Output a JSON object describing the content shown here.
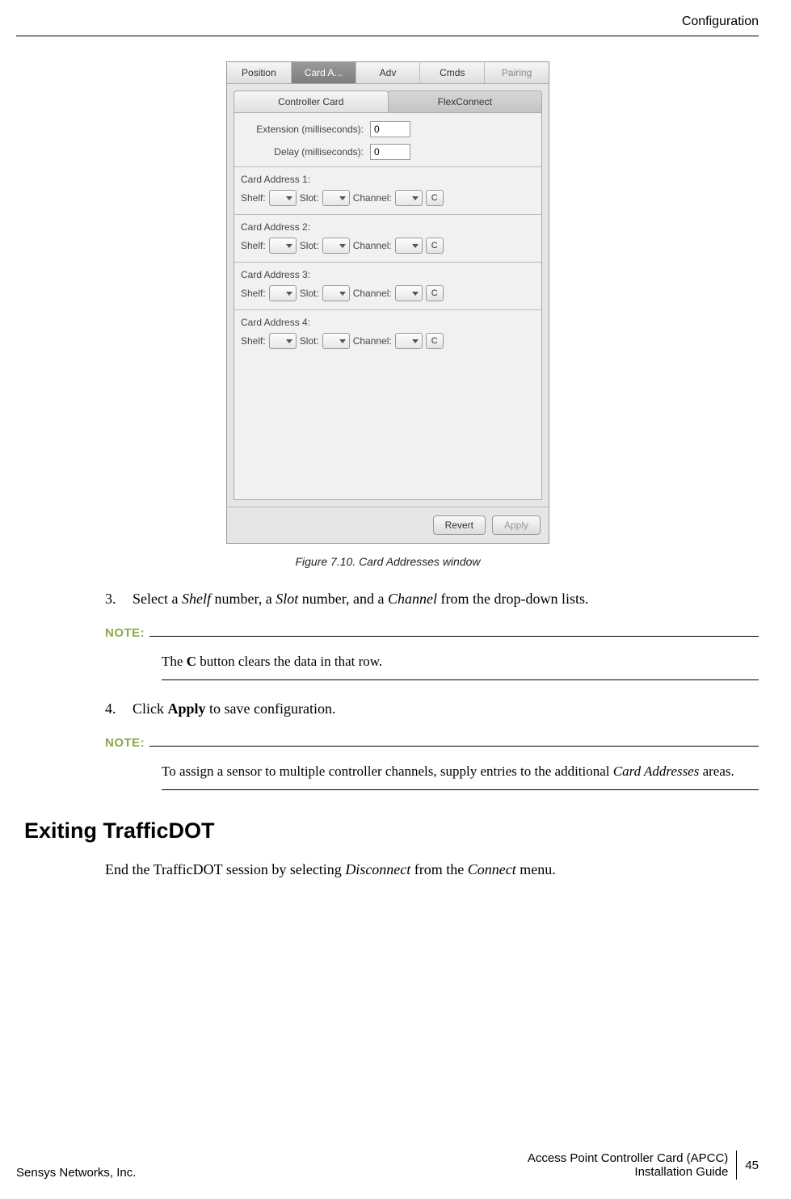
{
  "header": {
    "section": "Configuration"
  },
  "window": {
    "tabs": [
      "Position",
      "Card A...",
      "Adv",
      "Cmds",
      "Pairing"
    ],
    "active_tab_index": 1,
    "subtabs": [
      "Controller Card",
      "FlexConnect"
    ],
    "active_subtab_index": 1,
    "fields": {
      "extension_label": "Extension (milliseconds):",
      "extension_value": "0",
      "delay_label": "Delay (milliseconds):",
      "delay_value": "0"
    },
    "groups": [
      {
        "title": "Card Address 1:",
        "shelf_label": "Shelf:",
        "slot_label": "Slot:",
        "channel_label": "Channel:",
        "clear_label": "C"
      },
      {
        "title": "Card Address 2:",
        "shelf_label": "Shelf:",
        "slot_label": "Slot:",
        "channel_label": "Channel:",
        "clear_label": "C"
      },
      {
        "title": "Card Address 3:",
        "shelf_label": "Shelf:",
        "slot_label": "Slot:",
        "channel_label": "Channel:",
        "clear_label": "C"
      },
      {
        "title": "Card Address 4:",
        "shelf_label": "Shelf:",
        "slot_label": "Slot:",
        "channel_label": "Channel:",
        "clear_label": "C"
      }
    ],
    "buttons": {
      "revert": "Revert",
      "apply": "Apply"
    }
  },
  "figure_caption": "Figure 7.10. Card Addresses window",
  "steps": {
    "s3_num": "3.",
    "s3_a": "Select a ",
    "s3_shelf": "Shelf",
    "s3_b": " number, a ",
    "s3_slot": "Slot",
    "s3_c": " number, and a ",
    "s3_channel": "Channel",
    "s3_d": " from the drop-down lists.",
    "s4_num": "4.",
    "s4_a": "Click ",
    "s4_apply": "Apply",
    "s4_b": " to save configuration."
  },
  "notes": {
    "label": "NOTE:",
    "n1_a": "The ",
    "n1_c": "C",
    "n1_b": " button clears the data in that row.",
    "n2_a": "To assign a sensor to multiple controller channels, supply entries to the additional ",
    "n2_i": "Card Addresses",
    "n2_b": " areas."
  },
  "section_heading": "Exiting TrafficDOT",
  "section_body": {
    "a": "End the TrafficDOT session by selecting ",
    "disconnect": "Disconnect",
    "b": " from the ",
    "connect": "Connect",
    "c": " menu."
  },
  "footer": {
    "left": "Sensys Networks, Inc.",
    "right_line1": "Access Point Controller Card (APCC)",
    "right_line2": "Installation Guide",
    "page_num": "45"
  }
}
